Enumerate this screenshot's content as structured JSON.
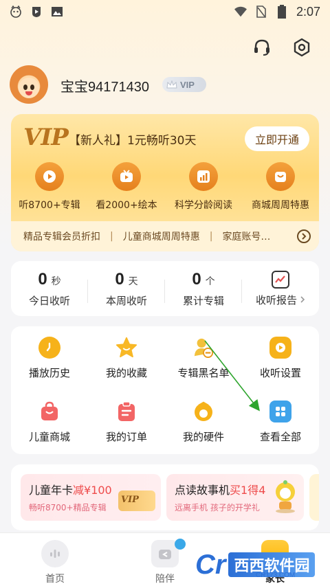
{
  "status_bar": {
    "time": "2:07",
    "icons": [
      "app-notification-icon",
      "play-store-icon",
      "image-icon",
      "wifi-icon",
      "no-sim-icon",
      "battery-icon"
    ]
  },
  "header": {
    "icons": [
      "headset-icon",
      "settings-icon"
    ]
  },
  "profile": {
    "username": "宝宝94171430",
    "badge": "VIP"
  },
  "vip_card": {
    "logo": "VIP",
    "promo": "【新人礼】1元畅听30天",
    "open_button": "立即开通",
    "perks": [
      {
        "label": "听8700+专辑",
        "icon": "play-icon"
      },
      {
        "label": "看2000+绘本",
        "icon": "tv-icon"
      },
      {
        "label": "科学分龄阅读",
        "icon": "chart-icon"
      },
      {
        "label": "商城周周特惠",
        "icon": "shop-icon"
      }
    ],
    "marquee": [
      "精品专辑会员折扣",
      "儿童商城周周特惠",
      "家庭账号…"
    ]
  },
  "stats": [
    {
      "value": "0",
      "unit": "秒",
      "label": "今日收听"
    },
    {
      "value": "0",
      "unit": "天",
      "label": "本周收听"
    },
    {
      "value": "0",
      "unit": "个",
      "label": "累计专辑"
    }
  ],
  "report": {
    "label": "收听报告"
  },
  "functions": [
    {
      "label": "播放历史",
      "icon": "history-icon",
      "color": "#f6b21a"
    },
    {
      "label": "我的收藏",
      "icon": "star-icon",
      "color": "#f8b826"
    },
    {
      "label": "专辑黑名单",
      "icon": "blacklist-icon",
      "color": "#f2c13c"
    },
    {
      "label": "收听设置",
      "icon": "listen-settings-icon",
      "color": "#f6b21a"
    },
    {
      "label": "儿童商城",
      "icon": "shopping-bag-icon",
      "color": "#f26565"
    },
    {
      "label": "我的订单",
      "icon": "order-icon",
      "color": "#f26565"
    },
    {
      "label": "我的硬件",
      "icon": "hardware-icon",
      "color": "#f6b21a"
    },
    {
      "label": "查看全部",
      "icon": "all-grid-icon",
      "color": "#3fa3ea"
    }
  ],
  "banners": [
    {
      "title": "儿童年卡",
      "highlight": "减¥100",
      "subtitle": "畅听8700+精品专辑",
      "art": "VIP"
    },
    {
      "title": "点读故事机",
      "highlight": "买1得4",
      "subtitle": "远离手机 孩子的开学礼"
    }
  ],
  "bottom_nav": [
    {
      "label": "首页",
      "icon": "home-icon"
    },
    {
      "label": "陪伴",
      "icon": "companion-icon"
    },
    {
      "label": "家长",
      "icon": "parent-icon"
    }
  ],
  "watermark": {
    "text": "西西软件园",
    "sub": "CR173.COM"
  }
}
